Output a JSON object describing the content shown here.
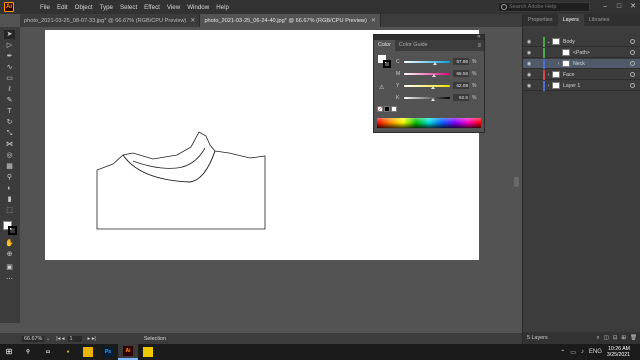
{
  "menubar": {
    "app_icon": "Ai",
    "items": [
      "File",
      "Edit",
      "Object",
      "Type",
      "Select",
      "Effect",
      "View",
      "Window",
      "Help"
    ],
    "search_placeholder": "Search Adobe Help",
    "window_controls": [
      "–",
      "□",
      "✕"
    ]
  },
  "tabs": [
    {
      "label": "photo_2021-03-25_08-07-33.jpg* @ 66.67% (RGB/CPU Preview)",
      "close": "✕",
      "active": false
    },
    {
      "label": "photo_2021-03-25_06-24-40.jpg* @ 66.67% (RGB/CPU Preview)",
      "close": "✕",
      "active": true
    }
  ],
  "tools": [
    "selection-tool",
    "direct-selection-tool",
    "pen-tool",
    "curvature-tool",
    "rectangle-tool",
    "paintbrush-tool",
    "pencil-tool",
    "type-tool",
    "rotate-tool",
    "scale-tool",
    "width-tool",
    "shape-builder-tool",
    "perspective-tool",
    "mesh-tool",
    "eyedropper-tool",
    "blend-tool",
    "symbol-sprayer-tool",
    "column-graph-tool",
    "artboard-tool",
    "slice-tool",
    "hand-tool",
    "zoom-tool"
  ],
  "color_panel": {
    "tabs": [
      "Color",
      "Color Guide"
    ],
    "menu_icon": "≡",
    "close_icon": "✕",
    "rows": [
      {
        "label": "C",
        "value": "67.96",
        "unit": "%",
        "level": 0.68,
        "gradient": "linear-gradient(to right,#ffffff,#00a0e0)"
      },
      {
        "label": "M",
        "value": "65.56",
        "unit": "%",
        "level": 0.66,
        "gradient": "linear-gradient(to right,#ffffff,#e0007a)"
      },
      {
        "label": "Y",
        "value": "62.08",
        "unit": "%",
        "level": 0.62,
        "gradient": "linear-gradient(to right,#ffffff,#f0e000)"
      },
      {
        "label": "K",
        "value": "62.6",
        "unit": "%",
        "level": 0.63,
        "gradient": "linear-gradient(to right,#ffffff,#000000)"
      }
    ],
    "out_of_gamut_icon": "⚠",
    "swatches": [
      "none",
      "#000000",
      "#ffffff"
    ]
  },
  "layers_panel": {
    "tabs": [
      "Properties",
      "Layers",
      "Libraries"
    ],
    "rows": [
      {
        "name": "Body",
        "color": "#4aa84a",
        "indent": 0,
        "chevron": "⌄",
        "selected": false
      },
      {
        "name": "<Path>",
        "color": "#4aa84a",
        "indent": 1,
        "chevron": "",
        "selected": false
      },
      {
        "name": "Neck",
        "color": "#4a6fd6",
        "indent": 1,
        "chevron": "›",
        "selected": true
      },
      {
        "name": "Face",
        "color": "#d84848",
        "indent": 0,
        "chevron": "›",
        "selected": false
      },
      {
        "name": "Layer 1",
        "color": "#4a6fd6",
        "indent": 0,
        "chevron": "›",
        "selected": false
      }
    ],
    "eye_icon": "◉",
    "lock_icon": "🔒",
    "footer_count": "5 Layers"
  },
  "statusbar": {
    "zoom": "66.67%",
    "dropdown": "⌄",
    "nav_left": "|◂  ◂",
    "page": "1",
    "nav_right": "▸  ▸|",
    "mode": "Selection"
  },
  "taskbar": {
    "start": "⊞",
    "apps": [
      {
        "name": "search",
        "glyph": "⚲",
        "bg": "transparent",
        "fg": "#ffffff",
        "active": false
      },
      {
        "name": "task-view",
        "glyph": "▭",
        "bg": "transparent",
        "fg": "#ffffff",
        "active": false
      },
      {
        "name": "chrome",
        "glyph": "●",
        "bg": "transparent",
        "fg": "#e8b400",
        "active": false
      },
      {
        "name": "file-explorer",
        "glyph": "▬",
        "bg": "#e8b400",
        "fg": "#e8b400",
        "active": false
      },
      {
        "name": "photoshop",
        "glyph": "Ps",
        "bg": "#001e36",
        "fg": "#31a8ff",
        "active": false
      },
      {
        "name": "illustrator",
        "glyph": "Ai",
        "bg": "#330000",
        "fg": "#ff9a00",
        "active": true
      },
      {
        "name": "sticky",
        "glyph": "■",
        "bg": "#f0c800",
        "fg": "#f0c800",
        "active": false
      }
    ],
    "tray": [
      "⌃",
      "▭",
      "♪",
      "ENG"
    ],
    "time": "10:26 AM",
    "date": "3/25/2021"
  }
}
